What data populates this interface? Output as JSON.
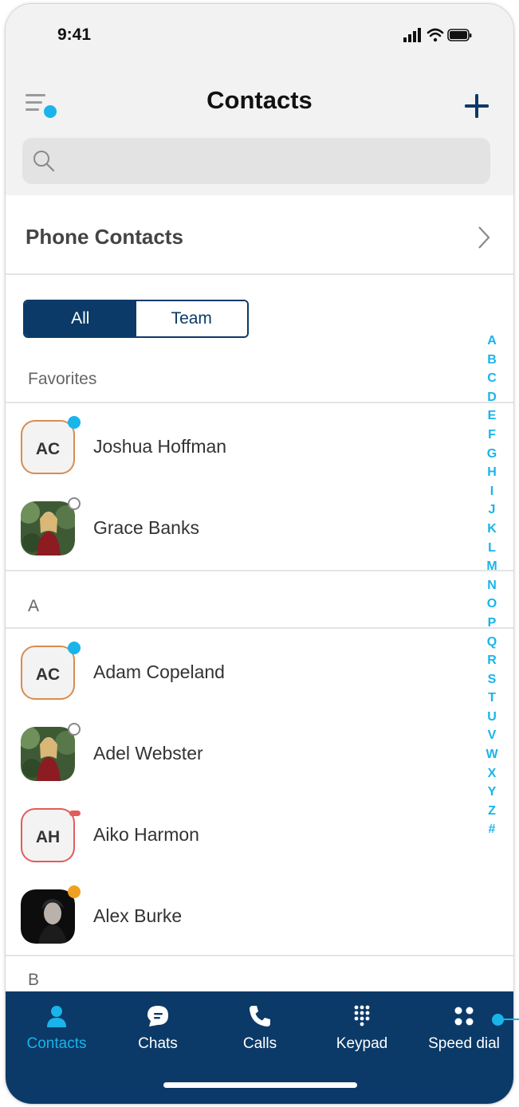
{
  "status_bar": {
    "time": "9:41"
  },
  "header": {
    "title": "Contacts"
  },
  "search": {
    "placeholder": ""
  },
  "phone_contacts": {
    "label": "Phone Contacts"
  },
  "segment": {
    "all": "All",
    "team": "Team"
  },
  "sections": {
    "favorites": "Favorites",
    "a": "A",
    "b": "B"
  },
  "favorites": [
    {
      "name": "Joshua Hoffman",
      "initials": "AC",
      "presence": "online"
    },
    {
      "name": "Grace Banks",
      "initials": "",
      "presence": "offline"
    }
  ],
  "a_contacts": [
    {
      "name": "Adam Copeland",
      "initials": "AC",
      "presence": "online"
    },
    {
      "name": "Adel Webster",
      "initials": "",
      "presence": "offline"
    },
    {
      "name": "Aiko Harmon",
      "initials": "AH",
      "presence": "busy"
    },
    {
      "name": "Alex Burke",
      "initials": "",
      "presence": "away"
    }
  ],
  "alphabet": [
    "A",
    "B",
    "C",
    "D",
    "E",
    "F",
    "G",
    "H",
    "I",
    "J",
    "K",
    "L",
    "M",
    "N",
    "O",
    "P",
    "Q",
    "R",
    "S",
    "T",
    "U",
    "V",
    "W",
    "X",
    "Y",
    "Z",
    "#"
  ],
  "tabs": [
    {
      "label": "Contacts",
      "icon": "person-icon",
      "active": true
    },
    {
      "label": "Chats",
      "icon": "chat-icon",
      "active": false
    },
    {
      "label": "Calls",
      "icon": "phone-icon",
      "active": false
    },
    {
      "label": "Keypad",
      "icon": "keypad-icon",
      "active": false
    },
    {
      "label": "Speed dial",
      "icon": "speed-dial-icon",
      "active": false
    }
  ],
  "colors": {
    "navy": "#0b3a68",
    "accent": "#19b4ea",
    "online": "#19b4ea",
    "busy": "#e35b5b",
    "away": "#f0a020",
    "avatar_border_orange": "#d98c4f",
    "avatar_border_red": "#e35b5b"
  }
}
